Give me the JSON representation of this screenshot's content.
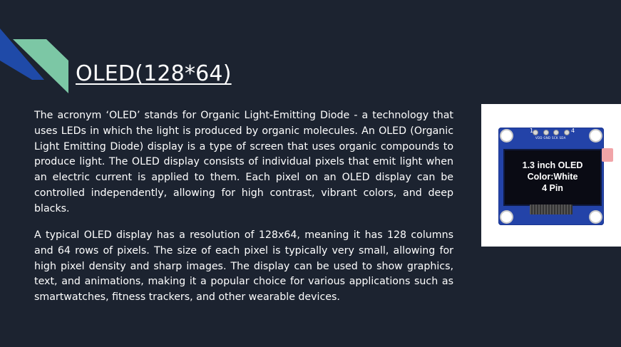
{
  "slide": {
    "title": "OLED(128*64)",
    "paragraph1": "The acronym ‘OLED’ stands for Organic Light-Emitting Diode - a technology that uses LEDs in which the light is produced by organic molecules. An OLED (Organic Light Emitting Diode) display is a type of screen that uses organic compounds to produce light. The OLED display consists of individual pixels that emit light when an electric current is applied to them. Each pixel on an OLED display can be controlled independently, allowing for high contrast, vibrant colors, and deep blacks.",
    "paragraph2": "A typical OLED display has a resolution of 128x64, meaning it has 128 columns and 64 rows of pixels. The size of each pixel is typically very small, allowing for high pixel density and sharp images. The display can be used to show graphics, text, and animations, making it a popular choice for various applications such as smartwatches, fitness trackers, and other wearable devices."
  },
  "image": {
    "screen_line1": "1.3 inch OLED",
    "screen_line2": "Color:White",
    "screen_line3": "4 Pin",
    "pin_start": "1",
    "pin_end": "4",
    "pin_labels": "VDD GND SCK SDA"
  },
  "colors": {
    "background": "#1c2330",
    "accent_blue": "#1f4aa8",
    "accent_green": "#7cc7a5",
    "pcb_blue": "#2343a8"
  }
}
